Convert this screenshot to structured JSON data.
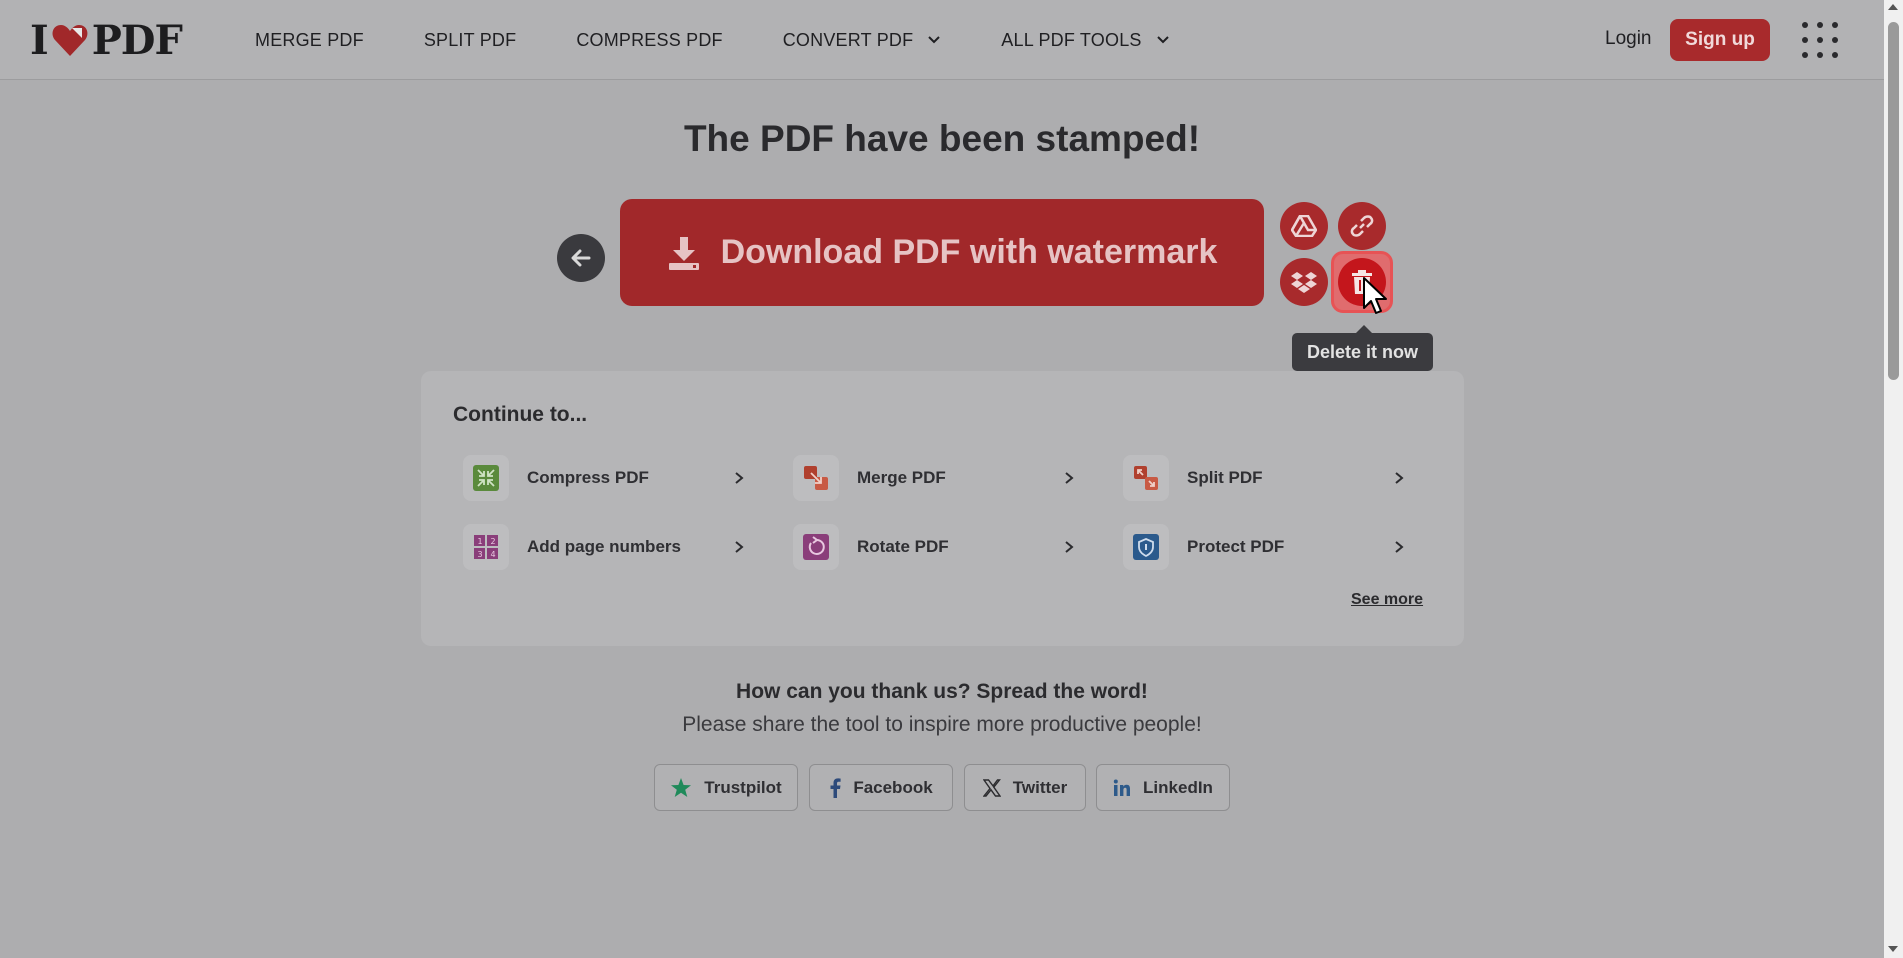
{
  "header": {
    "logo_left": "I",
    "logo_right": "PDF",
    "nav": [
      {
        "label": "MERGE PDF"
      },
      {
        "label": "SPLIT PDF"
      },
      {
        "label": "COMPRESS PDF"
      },
      {
        "label": "CONVERT PDF"
      },
      {
        "label": "ALL PDF TOOLS"
      }
    ],
    "login": "Login",
    "signup": "Sign up"
  },
  "result": {
    "title": "The PDF have been stamped!",
    "download_label": "Download PDF with watermark",
    "tooltip": "Delete it now"
  },
  "continue": {
    "title": "Continue to...",
    "tools": [
      {
        "label": "Compress PDF",
        "icon": "compress-icon",
        "color": "#5a8a3c"
      },
      {
        "label": "Merge PDF",
        "icon": "merge-icon",
        "color": "#b0402e"
      },
      {
        "label": "Split PDF",
        "icon": "split-icon",
        "color": "#b0402e"
      },
      {
        "label": "Add page numbers",
        "icon": "page-numbers-icon",
        "color": "#8a3e7a"
      },
      {
        "label": "Rotate PDF",
        "icon": "rotate-icon",
        "color": "#8a3e7a"
      },
      {
        "label": "Protect PDF",
        "icon": "shield-icon",
        "color": "#2b5a8c"
      }
    ],
    "see_more": "See more"
  },
  "share": {
    "title": "How can you thank us? Spread the word!",
    "subtitle": "Please share the tool to inspire more productive people!",
    "buttons": [
      {
        "label": "Trustpilot"
      },
      {
        "label": "Facebook"
      },
      {
        "label": "Twitter"
      },
      {
        "label": "LinkedIn"
      }
    ]
  },
  "colors": {
    "brand_red": "#a82a2c",
    "delete_red": "#c4161c"
  }
}
